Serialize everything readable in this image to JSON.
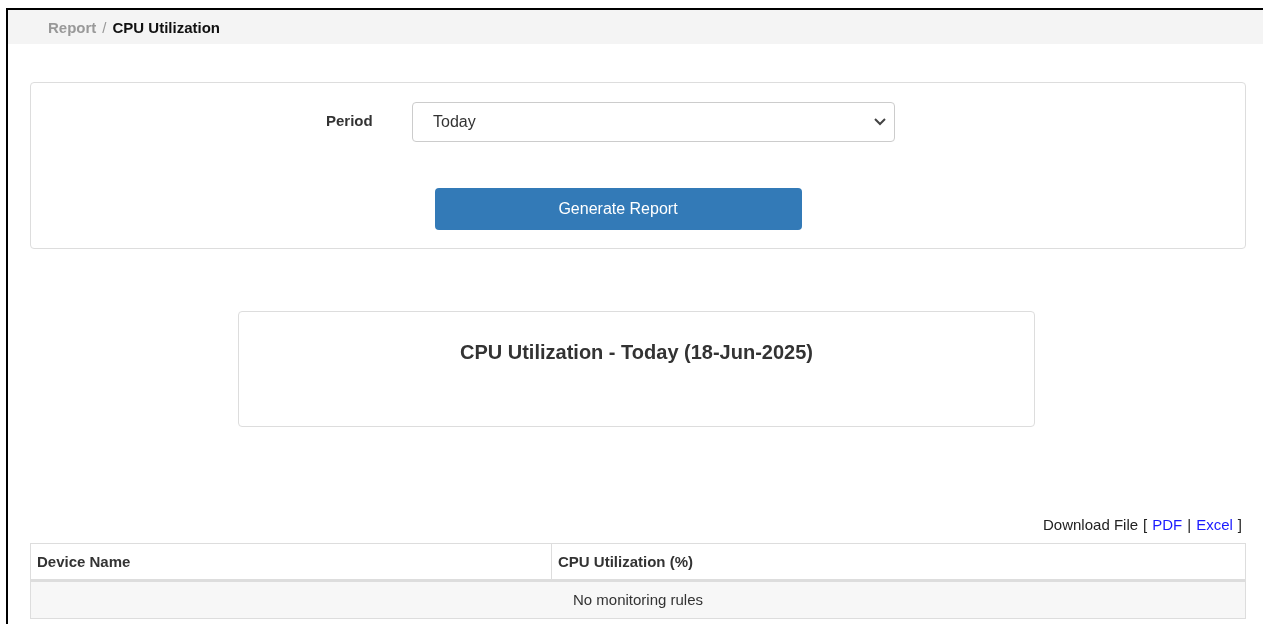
{
  "breadcrumb": [
    {
      "label": "Report",
      "current": false
    },
    {
      "label": "CPU Utilization",
      "current": true
    }
  ],
  "breadcrumb_separator": "/",
  "form": {
    "period_label": "Period",
    "period_value": "Today",
    "button": "Generate Report"
  },
  "report_title": "CPU Utilization - Today (18-Jun-2025)",
  "download": {
    "label": "Download File",
    "open_bracket": "[",
    "links": [
      "PDF",
      "Excel"
    ],
    "separator": "|",
    "close_bracket": "]"
  },
  "table": {
    "columns": [
      "Device Name",
      "CPU Utilization (%)"
    ],
    "empty_message": "No monitoring rules"
  }
}
